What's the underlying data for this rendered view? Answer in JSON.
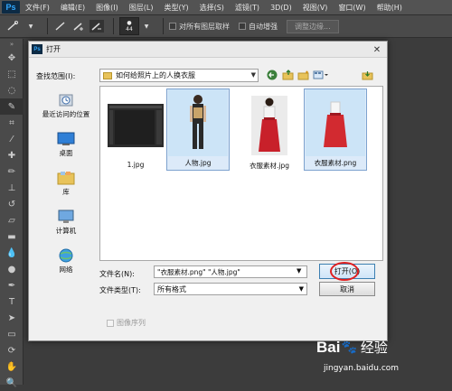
{
  "app": {
    "logo": "Ps"
  },
  "menu": [
    "文件(F)",
    "编辑(E)",
    "图像(I)",
    "图层(L)",
    "类型(Y)",
    "选择(S)",
    "滤镜(T)",
    "3D(D)",
    "视图(V)",
    "窗口(W)",
    "帮助(H)"
  ],
  "options_bar": {
    "brush_size": "44",
    "sample_all_layers": "对所有图层取样",
    "auto_enhance": "自动增强",
    "refine_edge": "调整边缘..."
  },
  "dialog": {
    "title": "打开",
    "look_in_label": "查找范围(I):",
    "look_in_value": "如何给照片上的人换衣服",
    "places": [
      {
        "label": "最近访问的位置",
        "icon": "recent-places-icon"
      },
      {
        "label": "桌面",
        "icon": "desktop-icon"
      },
      {
        "label": "库",
        "icon": "libraries-icon"
      },
      {
        "label": "计算机",
        "icon": "computer-icon"
      },
      {
        "label": "网络",
        "icon": "network-icon"
      }
    ],
    "files": [
      {
        "name": "1.jpg",
        "selected": false
      },
      {
        "name": "人物.jpg",
        "selected": true
      },
      {
        "name": "衣服素材.jpg",
        "selected": false
      },
      {
        "name": "衣服素材.png",
        "selected": true
      }
    ],
    "file_name_label": "文件名(N):",
    "file_name_value": "\"衣服素材.png\" \"人物.jpg\"",
    "file_type_label": "文件类型(T):",
    "file_type_value": "所有格式",
    "open_button": "打开(O)",
    "cancel_button": "取消",
    "image_sequence": "图像序列"
  },
  "watermark": {
    "brand": "Bai",
    "brand2": "经验",
    "url": "jingyan.baidu.com"
  },
  "colors": {
    "highlight_ring": "#e02020",
    "ps_blue": "#31a8ff"
  }
}
